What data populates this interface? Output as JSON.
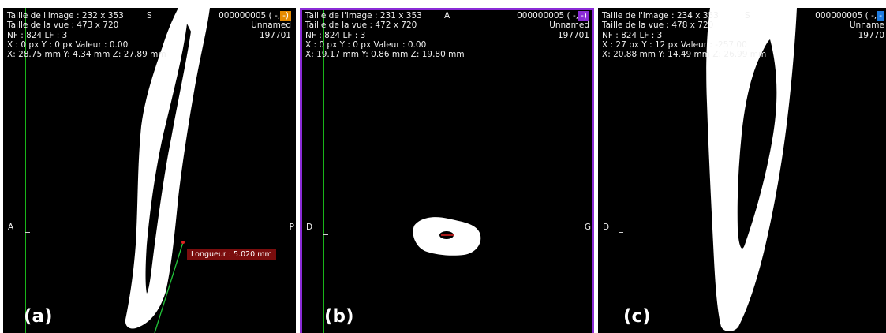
{
  "panels": [
    {
      "id": "a",
      "label": "(a)",
      "info": {
        "line1": "Taille de l'image : 232 x 353",
        "line2": "Taille de la vue : 473 x 720",
        "line3": "NF : 824 LF : 3",
        "line4": "X : 0 px Y : 0 px Valeur : 0.00",
        "line5": "X: 28.75 mm Y: 4.34 mm Z: 27.89 mm"
      },
      "orientation_top": "S",
      "slice_id": "000000005 (",
      "slice_suffix": "-,",
      "badge": "-)",
      "badge_color": "#e58a00",
      "name": "Unnamed",
      "code": "197701",
      "left_label": "A",
      "right_label": "P",
      "measure_label": "Longueur : 5.020 mm"
    },
    {
      "id": "b",
      "label": "(b)",
      "info": {
        "line1": "Taille de l'image : 231 x 353",
        "line2": "Taille de la vue : 472 x 720",
        "line3": "NF : 824 LF : 3",
        "line4": "X : 0 px Y : 0 px Valeur : 0.00",
        "line5": "X: 19.17 mm Y: 0.86 mm Z: 19.80 mm"
      },
      "orientation_top": "A",
      "slice_id": "000000005 (",
      "slice_suffix": "-,",
      "badge": "-)",
      "badge_color": "#8a2bd6",
      "name": "Unnamed",
      "code": "197701",
      "left_label": "D",
      "right_label": "G"
    },
    {
      "id": "c",
      "label": "(c)",
      "info": {
        "line1": "Taille de l'image : 234 x 353",
        "line2": "Taille de la vue : 478 x 720",
        "line3": "NF : 824 LF : 3",
        "line4": "X : 27 px Y : 12 px Valeur : -257.00",
        "line5": "X: 20.88 mm Y: 14.49 mm Z: 26.99 mm"
      },
      "orientation_top": "S",
      "slice_id": "000000005 (",
      "slice_suffix": "-,",
      "badge": "-",
      "badge_color": "#1e7be0",
      "name": "Unname",
      "code": "19770",
      "left_label": "D"
    }
  ],
  "colors": {
    "background": "#000000",
    "tooth": "#ffffff",
    "guide_line": "#19b319",
    "measure_line": "#22c43a",
    "measure_point": "#e02020",
    "active_border": "#8a2bd6"
  }
}
